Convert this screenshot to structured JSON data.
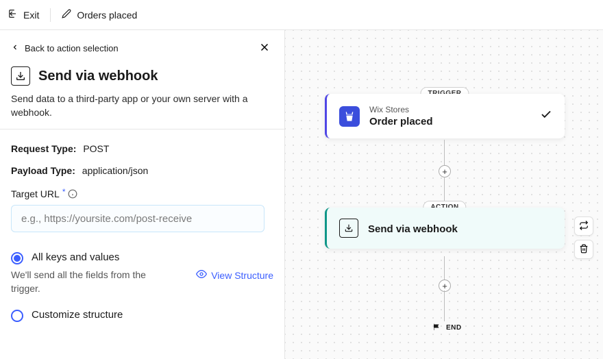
{
  "topbar": {
    "exit_label": "Exit",
    "title": "Orders placed"
  },
  "back": {
    "label": "Back to action selection"
  },
  "header": {
    "title": "Send via webhook",
    "description": "Send data to a third-party app or your own server with a webhook."
  },
  "form": {
    "request_type_label": "Request Type:",
    "request_type_value": "POST",
    "payload_type_label": "Payload Type:",
    "payload_type_value": "application/json",
    "target_url_label": "Target URL",
    "target_url_placeholder": "e.g., https://yoursite.com/post-receive"
  },
  "radio": {
    "all_label": "All keys and values",
    "all_desc": "We'll send all the fields from the trigger.",
    "view_structure_label": "View Structure",
    "customize_label": "Customize structure"
  },
  "canvas": {
    "trigger_pill": "TRIGGER",
    "trigger_subtitle": "Wix Stores",
    "trigger_title": "Order placed",
    "action_pill": "ACTION",
    "action_title": "Send via webhook",
    "end_label": "END"
  }
}
